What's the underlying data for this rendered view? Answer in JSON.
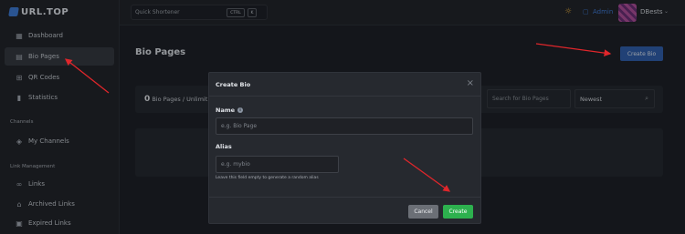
{
  "brand": {
    "name": "URL.TOP"
  },
  "sidebar": {
    "items": [
      {
        "label": "Dashboard",
        "icon": "grid-icon"
      },
      {
        "label": "Bio Pages",
        "icon": "page-icon",
        "active": true
      },
      {
        "label": "QR Codes",
        "icon": "qr-icon"
      },
      {
        "label": "Statistics",
        "icon": "bar-chart-icon"
      }
    ],
    "sections": [
      {
        "title": "Channels",
        "items": [
          {
            "label": "My Channels",
            "icon": "cube-icon"
          }
        ]
      },
      {
        "title": "Link Management",
        "items": [
          {
            "label": "Links",
            "icon": "link-icon"
          },
          {
            "label": "Archived Links",
            "icon": "archive-icon"
          },
          {
            "label": "Expired Links",
            "icon": "calendar-icon"
          }
        ]
      }
    ]
  },
  "topbar": {
    "quick_shortener": "Quick Shortener",
    "shortcut_keys": [
      "CTRL",
      "K"
    ],
    "admin_label": "Admin",
    "user_name": "DBests"
  },
  "main": {
    "title": "Bio Pages",
    "create_bio_button": "Create Bio",
    "count_number": "0",
    "count_text": "Bio Pages / Unlimit",
    "search_placeholder": "Search for Bio Pages",
    "sort_selected": "Newest"
  },
  "modal": {
    "title": "Create Bio",
    "name_label": "Name",
    "name_placeholder": "e.g. Bio Page",
    "alias_label": "Alias",
    "alias_placeholder": "e.g. mybio",
    "alias_hint": "Leave this field empty to generate a random alias",
    "cancel_button": "Cancel",
    "create_button": "Create"
  },
  "colors": {
    "accent_blue": "#2e5fae",
    "create_green": "#2db14e",
    "annotation_red": "#e0262b"
  }
}
